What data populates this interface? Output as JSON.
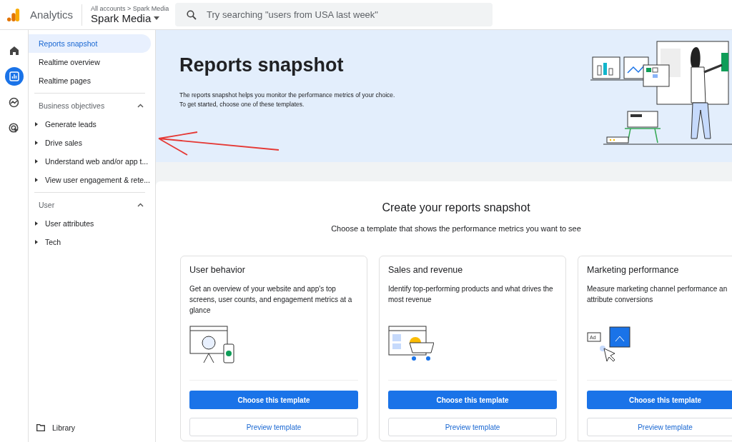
{
  "header": {
    "app_name": "Analytics",
    "breadcrumb": "All accounts > Spark Media",
    "account": "Spark Media",
    "search": {
      "placeholder": "Try searching \"users from USA last week\""
    }
  },
  "rail": [
    {
      "kind": "home",
      "selected": false
    },
    {
      "kind": "reports",
      "selected": true
    },
    {
      "kind": "explore",
      "selected": false
    },
    {
      "kind": "advertising",
      "selected": false
    }
  ],
  "sidebar": {
    "items": [
      {
        "label": "Reports snapshot",
        "selected": true
      },
      {
        "label": "Realtime overview",
        "selected": false
      },
      {
        "label": "Realtime pages",
        "selected": false
      }
    ],
    "sections": [
      {
        "title": "Business objectives",
        "expanded": true,
        "items": [
          {
            "label": "Generate leads"
          },
          {
            "label": "Drive sales"
          },
          {
            "label": "Understand web and/or app t..."
          },
          {
            "label": "View user engagement & rete..."
          }
        ]
      },
      {
        "title": "User",
        "expanded": true,
        "items": [
          {
            "label": "User attributes"
          },
          {
            "label": "Tech"
          }
        ]
      }
    ],
    "library": "Library"
  },
  "hero": {
    "title": "Reports snapshot",
    "description": [
      "The reports snapshot helps you monitor the performance metrics of your choice.",
      "To get started, choose one of these templates."
    ]
  },
  "templates": {
    "title": "Create your reports snapshot",
    "subtitle": "Choose a template that shows the performance metrics you want to see",
    "cards": [
      {
        "kind": "behavior",
        "title": "User behavior",
        "description": [
          "Get an overview of your website and app's top",
          "screens, user counts, and engagement metrics at a",
          "glance"
        ],
        "primary": "Choose this template",
        "secondary": "Preview template"
      },
      {
        "kind": "sales",
        "title": "Sales and revenue",
        "description": [
          "Identify top-performing products and what drives the",
          "most revenue"
        ],
        "primary": "Choose this template",
        "secondary": "Preview template"
      },
      {
        "kind": "marketing",
        "title": "Marketing performance",
        "description": [
          "Measure marketing channel performance an",
          "attribute conversions"
        ],
        "art_label": "Ad",
        "primary": "Choose this template",
        "secondary": "Preview template"
      }
    ]
  }
}
